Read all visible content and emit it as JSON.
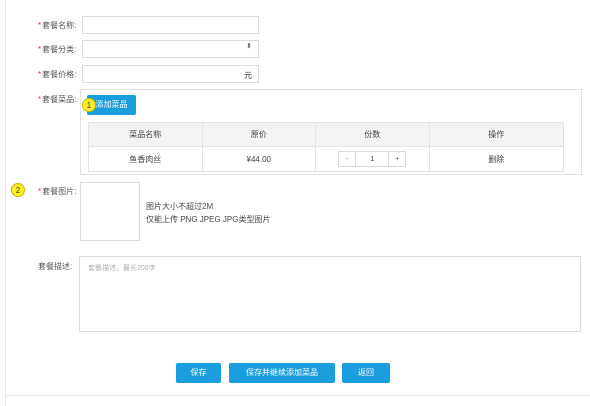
{
  "form": {
    "name": {
      "required_mark": "*",
      "label": "套餐名称:",
      "value": ""
    },
    "category": {
      "required_mark": "*",
      "label": "套餐分类:",
      "value": "",
      "arrow": "⬍"
    },
    "price": {
      "required_mark": "*",
      "label": "套餐价格:",
      "value": "",
      "suffix": "元"
    },
    "dishes": {
      "required_mark": "*",
      "label": "套餐菜品:",
      "add_button": "添加菜品",
      "columns": [
        "菜品名称",
        "原价",
        "份数",
        "操作"
      ],
      "rows": [
        {
          "name": "鱼香肉丝",
          "price": "¥44.00",
          "qty": "1",
          "minus": "-",
          "plus": "+",
          "action": "删除"
        }
      ]
    },
    "image": {
      "required_mark": "*",
      "label": "套餐图片:",
      "hint_line1": "图片大小不超过2M",
      "hint_line2": "仅能上传 PNG JPEG JPG类型图片"
    },
    "description": {
      "label": "套餐描述:",
      "placeholder": "套餐描述，最长200字"
    }
  },
  "annotations": {
    "badge_1": "1",
    "badge_2": "2"
  },
  "actions": {
    "save": "保存",
    "save_continue": "保存并继续添加菜品",
    "back": "返回"
  },
  "colors": {
    "primary": "#1a9ede",
    "required": "#e53935",
    "badge": "#ffee22"
  }
}
